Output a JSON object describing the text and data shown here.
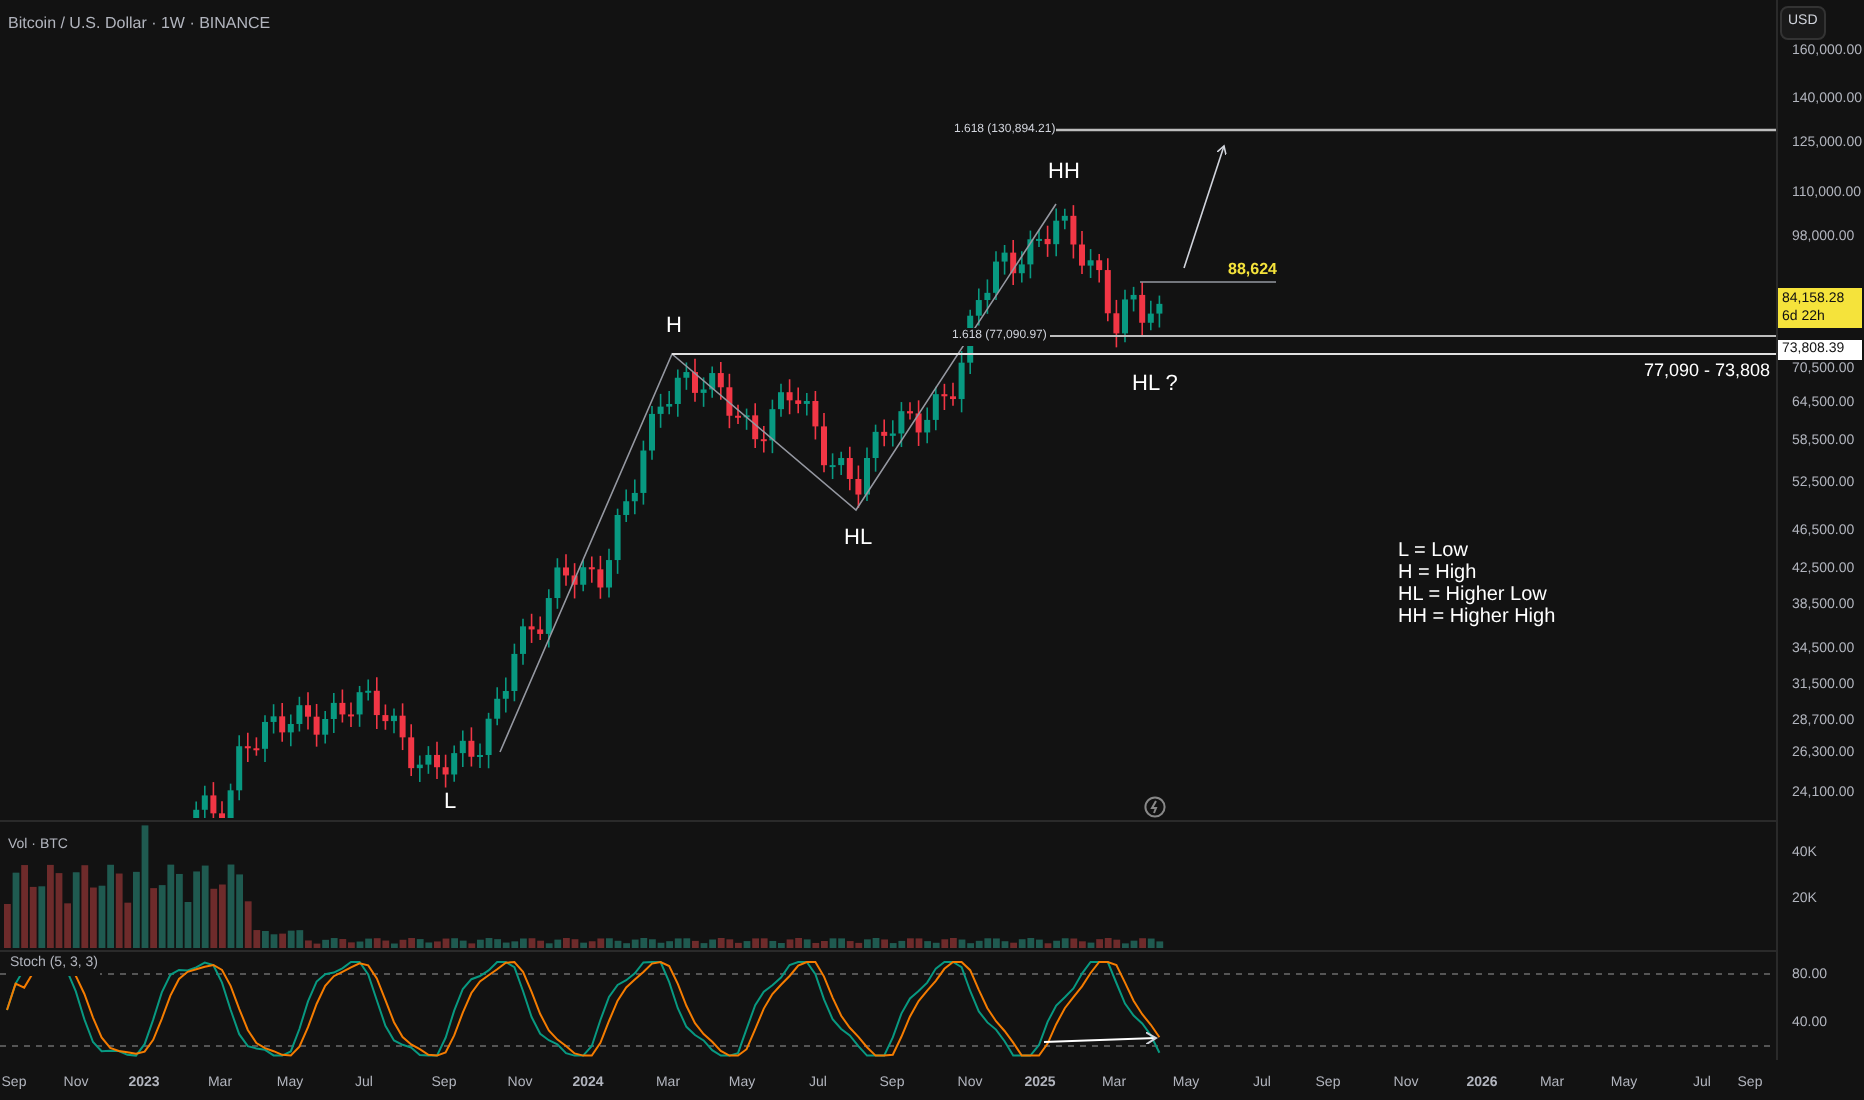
{
  "chart_title": "Bitcoin / U.S. Dollar · 1W · BINANCE",
  "price_axis": {
    "currency": "USD",
    "labels": [
      "160,000.00",
      "140,000.00",
      "125,000.00",
      "110,000.00",
      "98,000.00",
      "70,500.00",
      "64,500.00",
      "58,500.00",
      "52,500.00",
      "46,500.00",
      "42,500.00",
      "38,500.00",
      "34,500.00",
      "31,500.00",
      "28,700.00",
      "26,300.00",
      "24,100.00"
    ]
  },
  "current_price": {
    "price": "84,158.28",
    "countdown": "6d 22h"
  },
  "level_tag": "73,808.39",
  "pivot_labels": [
    {
      "text": "L"
    },
    {
      "text": "H"
    },
    {
      "text": "HL"
    },
    {
      "text": "HH"
    },
    {
      "text": "HL ?"
    }
  ],
  "fib_levels": [
    {
      "label": "1.618 (130,894.21)"
    },
    {
      "label": "1.618 (77,090.97)"
    }
  ],
  "target_label": "88,624",
  "range_label": "77,090 - 73,808",
  "legend": [
    "L = Low",
    "H = High",
    "HL = Higher Low",
    "HH = Higher High"
  ],
  "volume_pane": {
    "title": "Vol · BTC",
    "axis_labels": [
      "40K",
      "20K"
    ]
  },
  "stoch_pane": {
    "title": "Stoch (5, 3, 3)",
    "axis_labels": [
      "80.00",
      "40.00"
    ]
  },
  "time_axis": [
    "Sep",
    "Nov",
    "2023",
    "Mar",
    "May",
    "Jul",
    "Sep",
    "Nov",
    "2024",
    "Mar",
    "May",
    "Jul",
    "Sep",
    "Nov",
    "2025",
    "Mar",
    "May",
    "Jul",
    "Sep",
    "Nov",
    "2026",
    "Mar",
    "May",
    "Jul",
    "Sep"
  ]
}
